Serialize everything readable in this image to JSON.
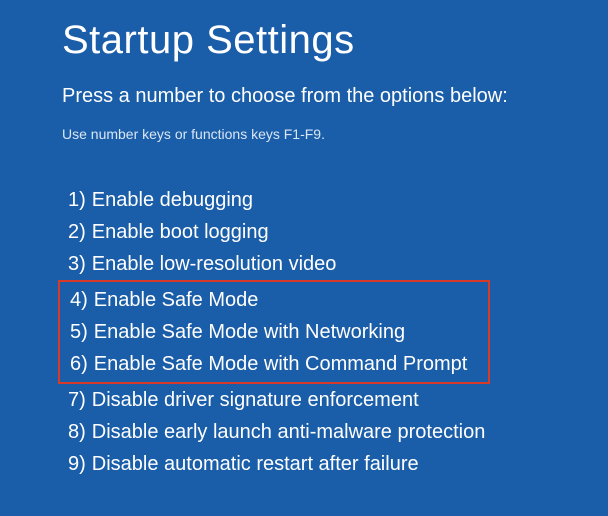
{
  "title": "Startup Settings",
  "subtitle": "Press a number to choose from the options below:",
  "hint": "Use number keys or functions keys F1-F9.",
  "options": [
    {
      "num": "1)",
      "label": "Enable debugging"
    },
    {
      "num": "2)",
      "label": "Enable boot logging"
    },
    {
      "num": "3)",
      "label": "Enable low-resolution video"
    },
    {
      "num": "4)",
      "label": "Enable Safe Mode"
    },
    {
      "num": "5)",
      "label": "Enable Safe Mode with Networking"
    },
    {
      "num": "6)",
      "label": "Enable Safe Mode with Command Prompt"
    },
    {
      "num": "7)",
      "label": "Disable driver signature enforcement"
    },
    {
      "num": "8)",
      "label": "Disable early launch anti-malware protection"
    },
    {
      "num": "9)",
      "label": "Disable automatic restart after failure"
    }
  ],
  "highlight": {
    "start": 3,
    "end": 5
  },
  "colors": {
    "background": "#1a5da8",
    "text": "#ffffff",
    "hint": "#d9e6f5",
    "highlight_border": "#d83a2a"
  }
}
